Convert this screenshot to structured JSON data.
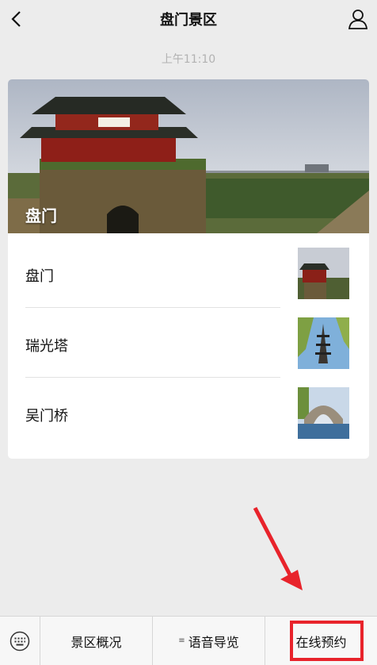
{
  "header": {
    "title": "盘门景区",
    "back_icon": "chevron-left-icon",
    "profile_icon": "user-icon"
  },
  "chat": {
    "time": "上午11:10"
  },
  "card": {
    "hero_title": "盘门",
    "items": [
      {
        "label": "盘门"
      },
      {
        "label": "瑞光塔"
      },
      {
        "label": "吴门桥"
      }
    ]
  },
  "tabbar": {
    "keyboard_icon": "keyboard-icon",
    "menu_icon": "menu-icon",
    "items": [
      {
        "label": "景区概况"
      },
      {
        "label": "语音导览"
      },
      {
        "label": "在线预约"
      }
    ]
  },
  "annotation": {
    "color": "#e8232b"
  }
}
